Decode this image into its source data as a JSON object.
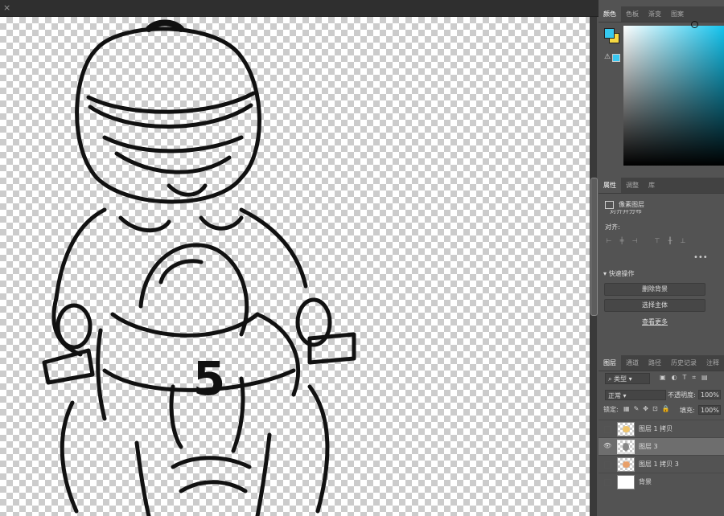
{
  "document_tab": {
    "close_glyph": "×"
  },
  "color_panel": {
    "tabs": [
      "颜色",
      "色板",
      "渐变",
      "图案"
    ],
    "foreground": "#35c9f0",
    "background": "#f6d842",
    "gamut_warning_icon": "warning-icon",
    "warning_glyph": "⚠"
  },
  "properties_panel": {
    "tabs": [
      "属性",
      "调整",
      "库"
    ],
    "layer_type": "像素图层",
    "truncated_heading": "对齐并分布",
    "align_label": "对齐:",
    "more_glyph": "•••",
    "quick_actions_title": "快速操作",
    "remove_bg_button": "删除背景",
    "select_subject_button": "选择主体",
    "view_more_link": "查看更多"
  },
  "layers_panel": {
    "tabs": [
      "图层",
      "通道",
      "路径",
      "历史记录",
      "注释"
    ],
    "kind_filter": "类型",
    "blend_mode": "正常",
    "opacity_label": "不透明度:",
    "opacity_value": "100%",
    "lock_label": "锁定:",
    "fill_label": "填充:",
    "fill_value": "100%",
    "eye_glyph": "👁",
    "layers": [
      {
        "name": "图层 1 拷贝",
        "visible": false,
        "selected": false
      },
      {
        "name": "图层 3",
        "visible": true,
        "selected": true
      },
      {
        "name": "图层 1 拷贝 3",
        "visible": false,
        "selected": false
      },
      {
        "name": "背景",
        "visible": false,
        "selected": false
      }
    ]
  },
  "canvas": {
    "content": "line-art-frog-motorcycle-rider",
    "number_on_bike": "5"
  }
}
